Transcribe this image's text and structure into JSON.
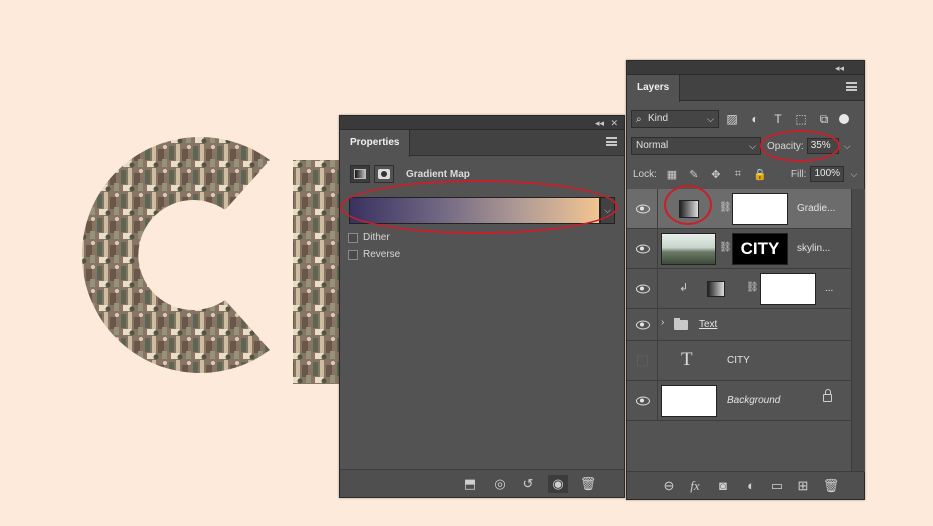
{
  "properties_panel": {
    "tab_label": "Properties",
    "adjustment_title": "Gradient Map",
    "gradient_colors": [
      "#3b3161",
      "#f2c592"
    ],
    "dither_label": "Dither",
    "reverse_label": "Reverse",
    "footer_buttons": [
      "clip-to-layer-icon",
      "view-previous-icon",
      "reset-icon",
      "visibility-eye-icon",
      "trash-icon"
    ]
  },
  "layers_panel": {
    "tab_label": "Layers",
    "filter_kind": "Kind",
    "blend_mode": "Normal",
    "opacity_label": "Opacity:",
    "opacity_value": "35%",
    "lock_label": "Lock:",
    "fill_label": "Fill:",
    "fill_value": "100%",
    "layers": [
      {
        "name": "Gradie...",
        "visible": true,
        "selected": true
      },
      {
        "name": "skylin...",
        "visible": true,
        "mask_text": "CITY"
      },
      {
        "name": "...",
        "visible": true,
        "clipped": true
      },
      {
        "name": "Text",
        "visible": true,
        "type": "group"
      },
      {
        "name": "CITY",
        "visible": false,
        "type": "text"
      },
      {
        "name": "Background",
        "visible": true,
        "locked": true
      }
    ],
    "footer_buttons": [
      "link-layers-icon",
      "fx-icon",
      "add-mask-icon",
      "new-adjustment-icon",
      "new-group-icon",
      "new-layer-icon",
      "trash-icon"
    ]
  },
  "colors": {
    "canvas_background": "#fdeadb",
    "panel_background": "#535353",
    "annotation_red": "#c8202a"
  }
}
